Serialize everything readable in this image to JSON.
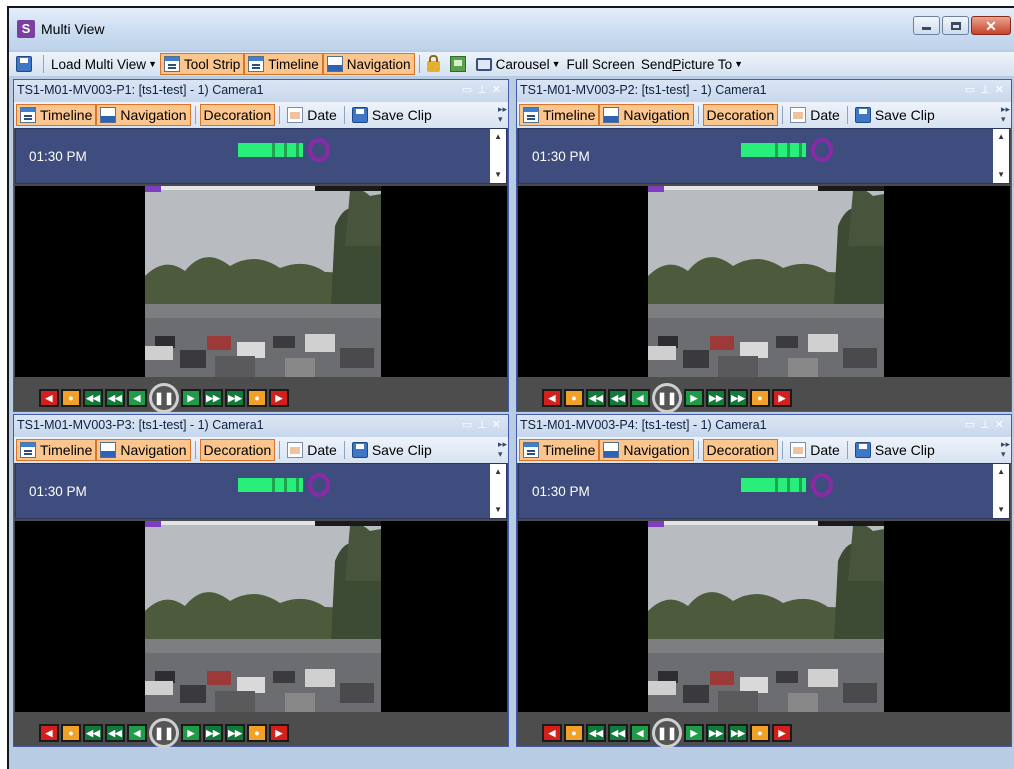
{
  "window": {
    "title": "Multi View",
    "app_icon_letter": "S"
  },
  "toolbar": {
    "load_multi_view": "Load Multi View",
    "tool_strip": "Tool Strip",
    "timeline": "Timeline",
    "navigation": "Navigation",
    "carousel": "Carousel",
    "full_screen": "Full Screen",
    "send_picture_prefix": "Send ",
    "send_picture_underlined": "P",
    "send_picture_suffix": "icture To"
  },
  "panels": [
    {
      "title": "TS1-M01-MV003-P1: [ts1-test] - 1) Camera1",
      "timeline_label": "Timeline",
      "navigation_label": "Navigation",
      "decoration_label": "Decoration",
      "date_label": "Date",
      "save_clip_label": "Save Clip",
      "time": "01:30 PM"
    },
    {
      "title": "TS1-M01-MV003-P2: [ts1-test] - 1) Camera1",
      "timeline_label": "Timeline",
      "navigation_label": "Navigation",
      "decoration_label": "Decoration",
      "date_label": "Date",
      "save_clip_label": "Save Clip",
      "time": "01:30 PM"
    },
    {
      "title": "TS1-M01-MV003-P3: [ts1-test] - 1) Camera1",
      "timeline_label": "Timeline",
      "navigation_label": "Navigation",
      "decoration_label": "Decoration",
      "date_label": "Date",
      "save_clip_label": "Save Clip",
      "time": "01:30 PM"
    },
    {
      "title": "TS1-M01-MV003-P4: [ts1-test] - 1) Camera1",
      "timeline_label": "Timeline",
      "navigation_label": "Navigation",
      "decoration_label": "Decoration",
      "date_label": "Date",
      "save_clip_label": "Save Clip",
      "time": "01:30 PM"
    }
  ],
  "colors": {
    "checked_button_bg": "#fbc68e",
    "timeline_strip_bg": "#3e4d7d",
    "recording_green": "#28ef79",
    "playhead_purple": "#8b2aa6"
  },
  "icons": {
    "save": "save-icon",
    "lock": "lock-icon",
    "export": "export-icon",
    "carousel": "monitor-icon",
    "date": "calendar-icon"
  }
}
